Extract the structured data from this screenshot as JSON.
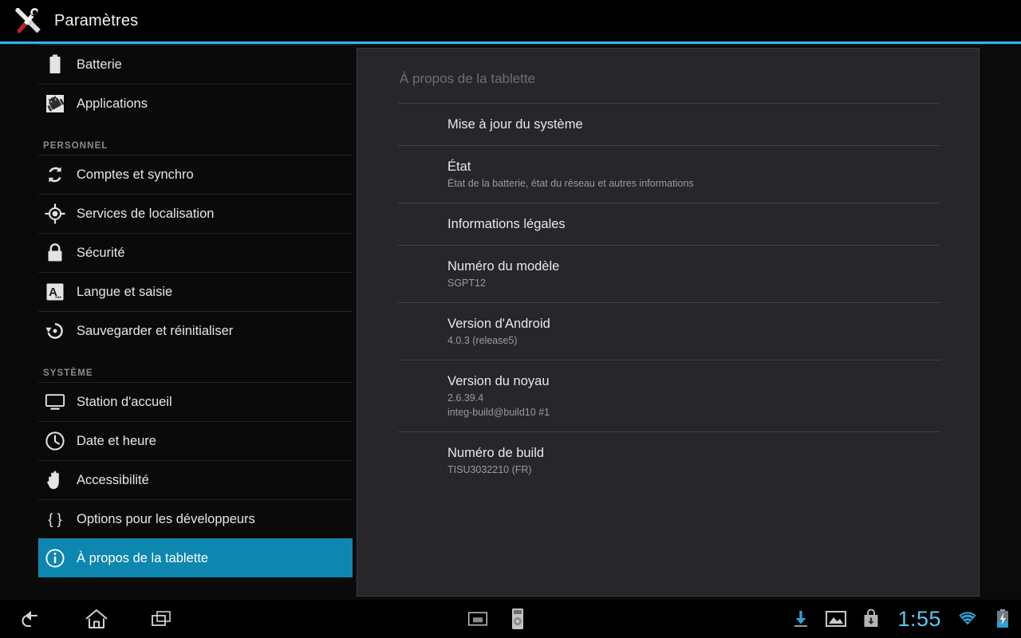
{
  "header": {
    "title": "Paramètres",
    "icon": "wrench-screwdriver-icon"
  },
  "colors": {
    "accent": "#33b5e5",
    "selection": "#0d87b0",
    "panel_bg": "#26262b",
    "sidebar_bg": "#0a0a0b",
    "clock": "#5bc8f0"
  },
  "sidebar": {
    "items": [
      {
        "label": "Batterie",
        "icon": "battery-icon",
        "type": "item",
        "selected": false
      },
      {
        "label": "Applications",
        "icon": "applications-icon",
        "type": "item",
        "selected": false
      },
      {
        "label": "PERSONNEL",
        "type": "header"
      },
      {
        "label": "Comptes et synchro",
        "icon": "sync-icon",
        "type": "item",
        "selected": false
      },
      {
        "label": "Services de localisation",
        "icon": "location-icon",
        "type": "item",
        "selected": false
      },
      {
        "label": "Sécurité",
        "icon": "lock-icon",
        "type": "item",
        "selected": false
      },
      {
        "label": "Langue et saisie",
        "icon": "language-icon",
        "type": "item",
        "selected": false
      },
      {
        "label": "Sauvegarder et réinitialiser",
        "icon": "backup-restore-icon",
        "type": "item",
        "selected": false
      },
      {
        "label": "SYSTÈME",
        "type": "header"
      },
      {
        "label": "Station d'accueil",
        "icon": "dock-monitor-icon",
        "type": "item",
        "selected": false
      },
      {
        "label": "Date et heure",
        "icon": "clock-icon",
        "type": "item",
        "selected": false
      },
      {
        "label": "Accessibilité",
        "icon": "hand-icon",
        "type": "item",
        "selected": false
      },
      {
        "label": "Options pour les développeurs",
        "icon": "braces-icon",
        "type": "item",
        "selected": false
      },
      {
        "label": "À propos de la tablette",
        "icon": "info-circle-icon",
        "type": "item",
        "selected": true
      }
    ]
  },
  "content": {
    "title": "À propos de la tablette",
    "rows": [
      {
        "title": "Mise à jour du système",
        "subs": []
      },
      {
        "title": "État",
        "subs": [
          "État de la batterie, état du réseau et autres informations"
        ]
      },
      {
        "title": "Informations légales",
        "subs": []
      },
      {
        "title": "Numéro du modèle",
        "subs": [
          "SGPT12"
        ]
      },
      {
        "title": "Version d'Android",
        "subs": [
          "4.0.3  (release5)"
        ]
      },
      {
        "title": "Version du noyau",
        "subs": [
          "2.6.39.4",
          "integ-build@build10 #1"
        ]
      },
      {
        "title": "Numéro de build",
        "subs": [
          "TISU3032210 (FR)"
        ]
      }
    ]
  },
  "systembar": {
    "back": "back-icon",
    "home": "home-icon",
    "recents": "recents-icon",
    "tray": [
      {
        "icon": "screen-cast-icon"
      },
      {
        "icon": "remote-control-icon"
      }
    ],
    "status": [
      {
        "icon": "download-icon"
      },
      {
        "icon": "photo-icon"
      },
      {
        "icon": "shopping-bag-download-icon"
      }
    ],
    "clock": "1:55",
    "wifi": "wifi-icon",
    "battery": "battery-charging-icon"
  }
}
